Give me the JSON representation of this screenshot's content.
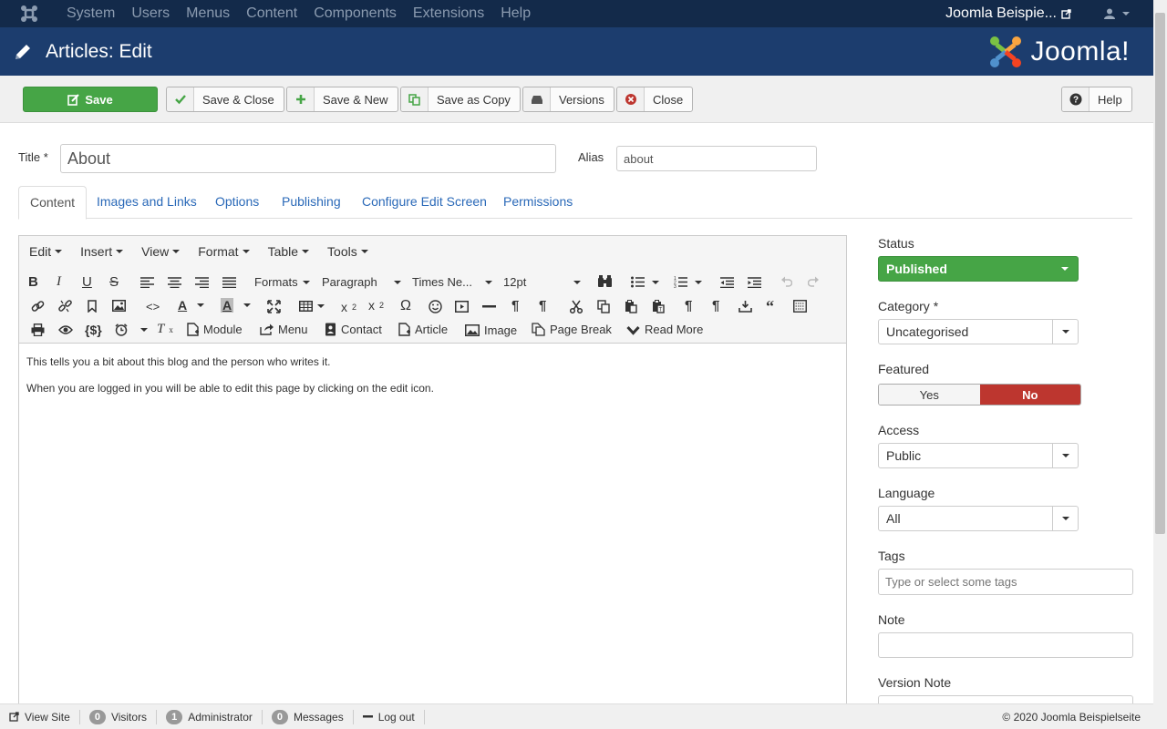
{
  "topnav": {
    "menu": [
      "System",
      "Users",
      "Menus",
      "Content",
      "Components",
      "Extensions",
      "Help"
    ],
    "site_name": "Joomla Beispie..."
  },
  "header": {
    "title": "Articles: Edit",
    "brand": "Joomla!"
  },
  "toolbar": {
    "save": "Save",
    "save_close": "Save & Close",
    "save_new": "Save & New",
    "save_copy": "Save as Copy",
    "versions": "Versions",
    "close": "Close",
    "help": "Help"
  },
  "form": {
    "title_label": "Title *",
    "title_value": "About",
    "alias_label": "Alias",
    "alias_value": "about"
  },
  "tabs": [
    "Content",
    "Images and Links",
    "Options",
    "Publishing",
    "Configure Edit Screen",
    "Permissions"
  ],
  "editor": {
    "menus": [
      "Edit",
      "Insert",
      "View",
      "Format",
      "Table",
      "Tools"
    ],
    "formats": "Formats",
    "block": "Paragraph",
    "font": "Times Ne...",
    "size": "12pt",
    "buttons": {
      "module": "Module",
      "menu": "Menu",
      "contact": "Contact",
      "article": "Article",
      "image": "Image",
      "page_break": "Page Break",
      "read_more": "Read More"
    },
    "paragraphs": [
      "This tells you a bit about this blog and the person who writes it.",
      "When you are logged in you will be able to edit this page by clicking on the edit icon."
    ]
  },
  "sidebar": {
    "status_label": "Status",
    "status_value": "Published",
    "category_label": "Category *",
    "category_value": "Uncategorised",
    "featured_label": "Featured",
    "featured_yes": "Yes",
    "featured_no": "No",
    "access_label": "Access",
    "access_value": "Public",
    "language_label": "Language",
    "language_value": "All",
    "tags_label": "Tags",
    "tags_placeholder": "Type or select some tags",
    "note_label": "Note",
    "note_value": "",
    "version_note_label": "Version Note"
  },
  "statusbar": {
    "view_site": "View Site",
    "visitors_count": "0",
    "visitors": "Visitors",
    "admin_count": "1",
    "admin": "Administrator",
    "messages_count": "0",
    "messages": "Messages",
    "logout": "Log out",
    "copyright": "© 2020 Joomla Beispielseite"
  },
  "colors": {
    "topnav_bg": "#132a4a",
    "header_bg": "#1c3d6e",
    "success": "#46a546",
    "danger": "#bd362f",
    "link": "#2a69b8"
  }
}
